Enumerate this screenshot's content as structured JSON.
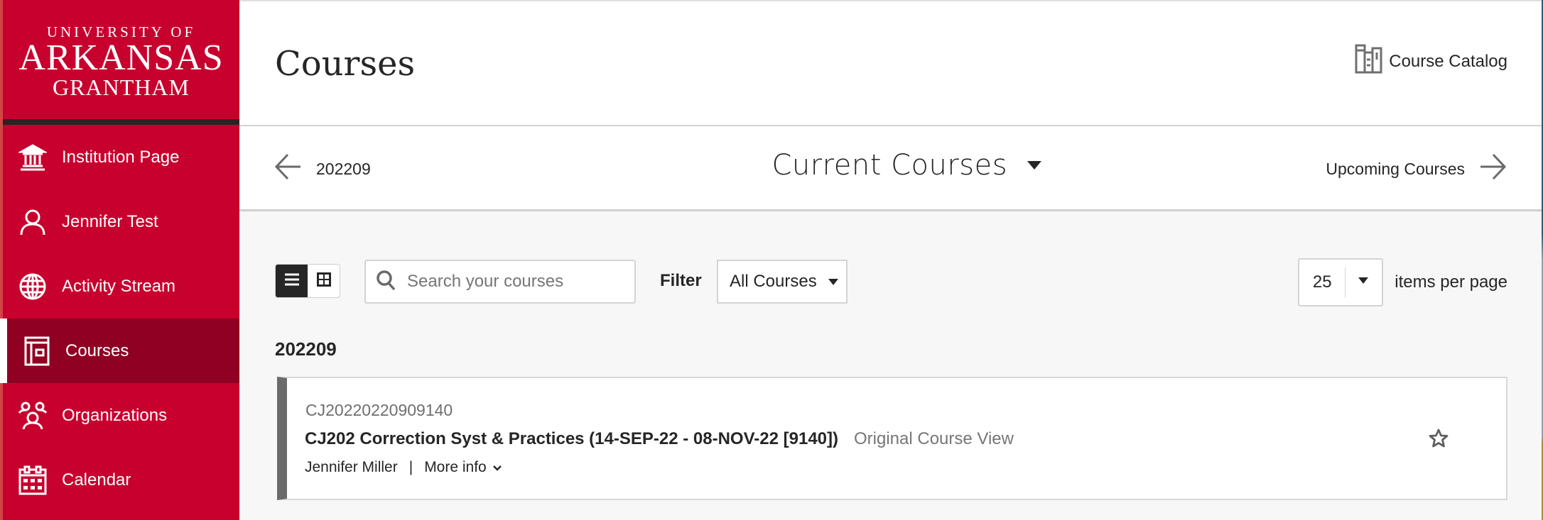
{
  "logo": {
    "line1": "UNIVERSITY OF",
    "line2": "ARKANSAS",
    "line3": "GRANTHAM"
  },
  "sidebar": {
    "items": [
      {
        "label": "Institution Page",
        "icon": "institution-icon",
        "active": false
      },
      {
        "label": "Jennifer Test",
        "icon": "user-icon",
        "active": false
      },
      {
        "label": "Activity Stream",
        "icon": "globe-icon",
        "active": false
      },
      {
        "label": "Courses",
        "icon": "courses-icon",
        "active": true
      },
      {
        "label": "Organizations",
        "icon": "organizations-icon",
        "active": false
      },
      {
        "label": "Calendar",
        "icon": "calendar-icon",
        "active": false
      }
    ]
  },
  "header": {
    "title": "Courses",
    "catalog_label": "Course Catalog"
  },
  "term_nav": {
    "previous_label": "202209",
    "current_label": "Current Courses",
    "next_label": "Upcoming Courses"
  },
  "toolbar": {
    "view_mode": "list",
    "search_placeholder": "Search your courses",
    "search_value": "",
    "filter_label": "Filter",
    "filter_value": "All Courses",
    "per_page_value": "25",
    "per_page_label": "items per page"
  },
  "term_group": {
    "heading": "202209",
    "courses": [
      {
        "id": "CJ20220220909140",
        "title": "CJ202 Correction Syst & Practices (14-SEP-22 - 08-NOV-22 [9140])",
        "view": "Original Course View",
        "instructor": "Jennifer Miller",
        "separator": "|",
        "more_info_label": "More info",
        "favorited": false
      }
    ]
  },
  "colors": {
    "brand_red": "#c8002e",
    "active_nav": "#8f0022",
    "logo_bar": "#2b2224",
    "card_accent": "#6b6b6b"
  }
}
